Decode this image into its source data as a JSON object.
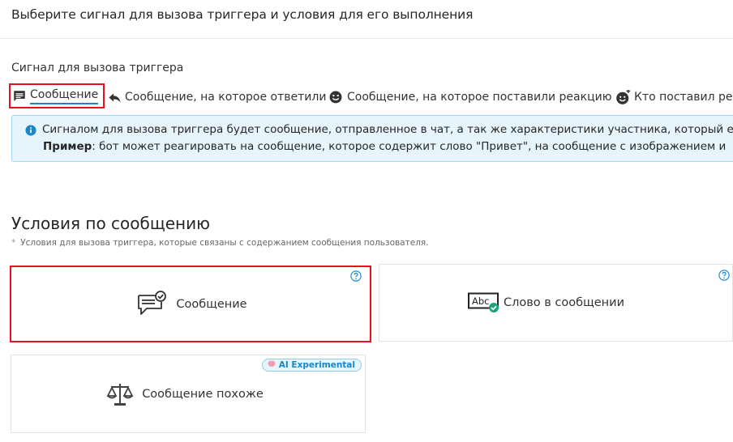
{
  "header": {
    "title": "Выберите сигнал для вызова триггера и условия для его выполнения"
  },
  "signal": {
    "label": "Сигнал для вызова триггера",
    "tabs": [
      {
        "label": "Сообщение",
        "icon": "chat-icon",
        "active": true
      },
      {
        "label": "Сообщение, на которое ответили",
        "icon": "reply-icon",
        "active": false
      },
      {
        "label": "Сообщение, на которое поставили реакцию",
        "icon": "smiley-icon",
        "active": false
      },
      {
        "label": "Кто поставил реа",
        "icon": "smiley-plus-icon",
        "active": false
      }
    ]
  },
  "info": {
    "line1": "Сигналом для вызова триггера будет сообщение, отправленное в чат, а так же характеристики участника, который е",
    "example_label": "Пример",
    "line2": ": бот может реагировать на сообщение, которое содержит слово \"Привет\", на сообщение с изображением и"
  },
  "conditions": {
    "title": "Условия по сообщению",
    "subtitle_marker": "*",
    "subtitle": "Условия для вызова триггера, которые связаны с содержанием сообщения пользователя.",
    "cards": [
      {
        "label": "Сообщение",
        "icon": "message-check-icon",
        "selected": true
      },
      {
        "label": "Слово в сообщении",
        "icon": "abc-check-icon",
        "selected": false
      },
      {
        "label": "Сообщение похоже",
        "icon": "scales-icon",
        "selected": false,
        "badge": "AI Experimental",
        "badge_icon": "brain-icon"
      }
    ]
  },
  "colors": {
    "accent": "#1b87c9",
    "highlight": "#e8101e",
    "info_bg": "#e6f4fc",
    "check_green": "#1aa37a"
  }
}
